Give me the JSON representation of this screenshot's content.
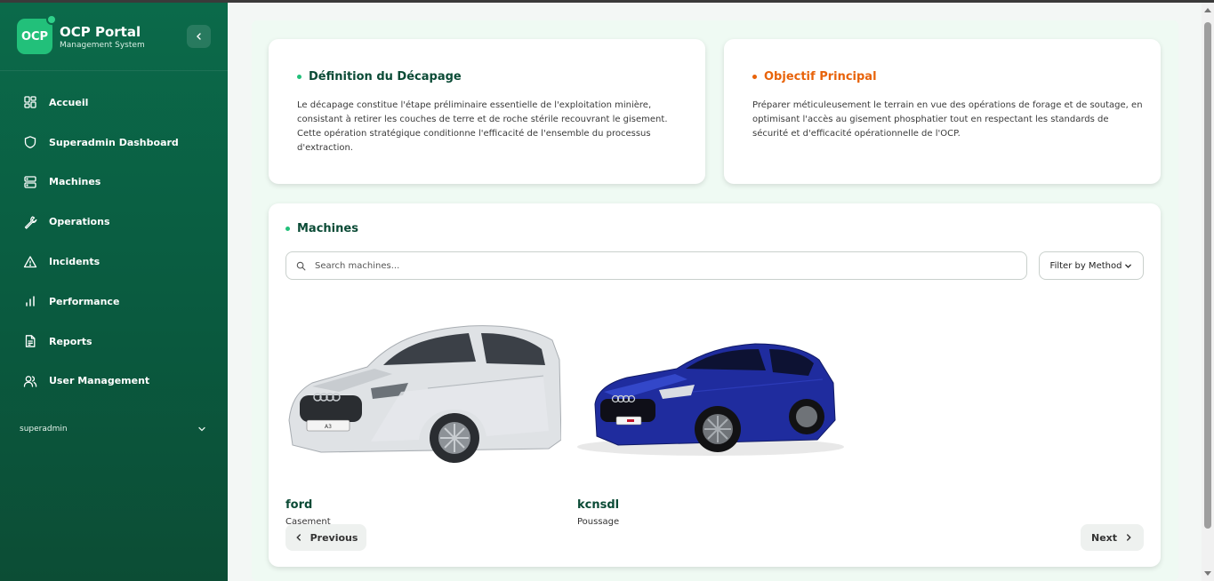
{
  "app": {
    "logo_text": "OCP",
    "title": "OCP Portal",
    "subtitle": "Management System"
  },
  "sidebar": {
    "items": [
      {
        "label": "Accueil",
        "icon": "grid-icon"
      },
      {
        "label": "Superadmin Dashboard",
        "icon": "shield-icon"
      },
      {
        "label": "Machines",
        "icon": "server-icon"
      },
      {
        "label": "Operations",
        "icon": "wrench-icon"
      },
      {
        "label": "Incidents",
        "icon": "alert-triangle-icon"
      },
      {
        "label": "Performance",
        "icon": "bar-chart-icon"
      },
      {
        "label": "Reports",
        "icon": "file-text-icon"
      },
      {
        "label": "User Management",
        "icon": "users-icon"
      }
    ],
    "user": "superadmin"
  },
  "definition": {
    "title": "Définition du Décapage",
    "text": "Le décapage constitue l'étape préliminaire essentielle de l'exploitation minière, consistant à retirer les couches de terre et de roche stérile recouvrant le gisement. Cette opération stratégique conditionne l'efficacité de l'ensemble du processus d'extraction."
  },
  "objective": {
    "title": "Objectif Principal",
    "text": "Préparer méticuleusement le terrain en vue des opérations de forage et de soutage, en optimisant l'accès au gisement phosphatier tout en respectant les standards de sécurité et d'efficacité opérationnelle de l'OCP."
  },
  "machines": {
    "title": "Machines",
    "search_placeholder": "Search machines...",
    "filter_label": "Filter by Method",
    "items": [
      {
        "name": "ford",
        "method": "Casement",
        "plate": "A3"
      },
      {
        "name": "kcnsdl",
        "method": "Poussage",
        "plate": ""
      }
    ],
    "previous_label": "Previous",
    "next_label": "Next"
  },
  "colors": {
    "brand_green": "#0b6a4a",
    "accent_green": "#22c07a",
    "accent_orange": "#e8630a",
    "title_green": "#0b4b36"
  }
}
